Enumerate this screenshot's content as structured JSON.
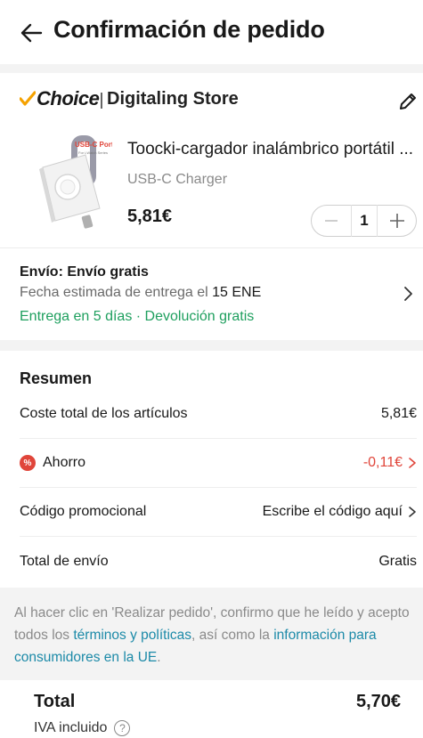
{
  "header": {
    "title": "Confirmación de pedido"
  },
  "store": {
    "brand": "Choice",
    "name": "Digitaling Store"
  },
  "product": {
    "title": "Toocki-cargador inalámbrico portátil ...",
    "variant": "USB-C Charger",
    "price": "5,81€",
    "quantity": "1",
    "image_label": "USB-C Port",
    "image_sublabel": "For i-Watch Series"
  },
  "shipping": {
    "title": "Envío: Envío gratis",
    "date_prefix": "Fecha estimada de entrega el",
    "date_value": "15 ENE",
    "promise": "Entrega en 5 días · Devolución gratis"
  },
  "summary": {
    "title": "Resumen",
    "rows": [
      {
        "label": "Coste total de los artículos",
        "value": "5,81€"
      },
      {
        "label": "Ahorro",
        "value": "-0,11€",
        "badge": "%"
      },
      {
        "label": "Código promocional",
        "value": "Escribe el código aquí"
      },
      {
        "label": "Total de envío",
        "value": "Gratis"
      }
    ]
  },
  "notice": {
    "text_1": "Al hacer clic en 'Realizar pedido', confirmo que he leído y acepto todos los",
    "link_1": "términos y políticas",
    "text_2": ", así como la",
    "link_2": "información para consumidores en la UE",
    "text_3": "."
  },
  "footer": {
    "total_label": "Total",
    "total_value": "5,70€",
    "vat_label": "IVA incluido"
  },
  "colors": {
    "accent_green": "#1e9f5e",
    "savings_red": "#e0453a",
    "link_blue": "#1c8aa8",
    "choice_yellow": "#f5a200"
  }
}
